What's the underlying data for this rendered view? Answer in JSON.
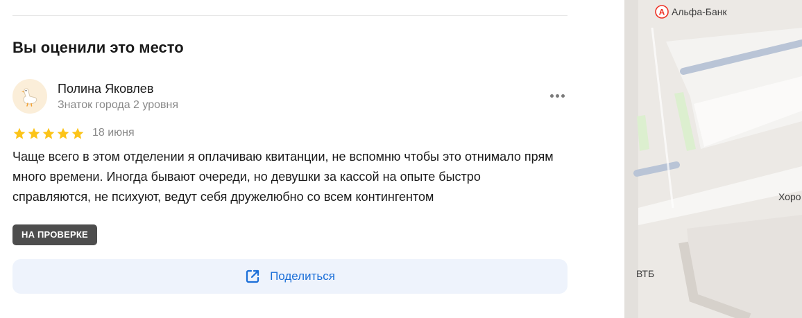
{
  "section": {
    "title": "Вы оценили это место"
  },
  "review": {
    "author_name": "Полина Яковлев",
    "author_level": "Знаток города 2 уровня",
    "rating": 5,
    "rating_max": 5,
    "date": "18 июня",
    "text": "Чаще всего в этом отделении я оплачиваю квитанции, не вспомню чтобы это отнимало прям много времени. Иногда бывают очереди, но девушки за кассой на опыте быстро справляются, не психуют, ведут себя дружелюбно со всем контингентом",
    "status_badge": "НА ПРОВЕРКЕ",
    "avatar_icon": "goose-icon",
    "more_icon": "more-dots-icon"
  },
  "share": {
    "label": "Поделиться",
    "icon": "share-icon"
  },
  "map": {
    "labels": {
      "alfa": "Альфа-Банк",
      "alfa_logo": "А",
      "vtb": "ВТБ",
      "hor": "Хоро"
    }
  },
  "colors": {
    "star": "#fcc419",
    "accent": "#1a6ed8",
    "badge_bg": "#4d4d4d",
    "share_bg": "#eef3fc",
    "alfa_red": "#ef3124"
  }
}
